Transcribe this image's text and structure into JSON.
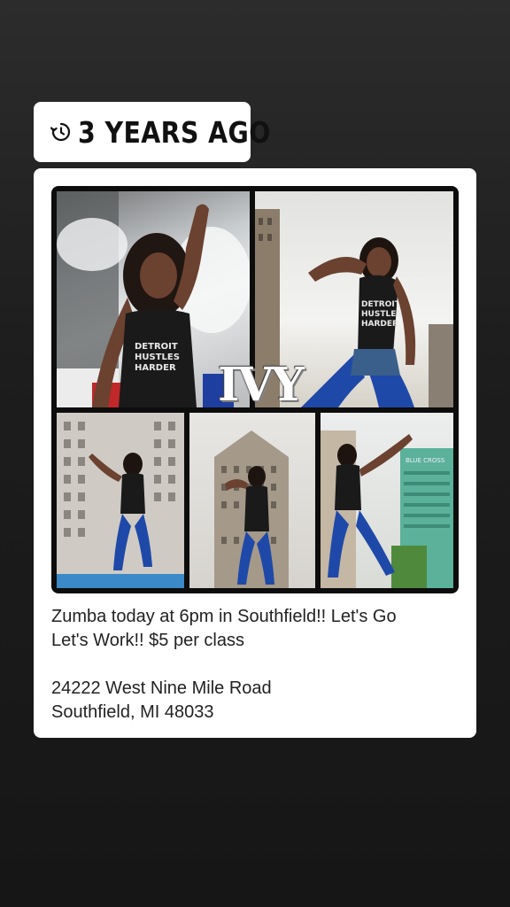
{
  "memory": {
    "icon": "history-icon",
    "label": "3 YEARS AGO"
  },
  "post": {
    "collage_overlay_text": "IVY",
    "shirt_text": "DETROIT HUSTLES HARDER",
    "caption": "Zumba today at 6pm in Southfield!! Let's Go\nLet's Work!! $5 per class\n\n24222 West Nine Mile Road\n Southfield, MI 48033"
  }
}
